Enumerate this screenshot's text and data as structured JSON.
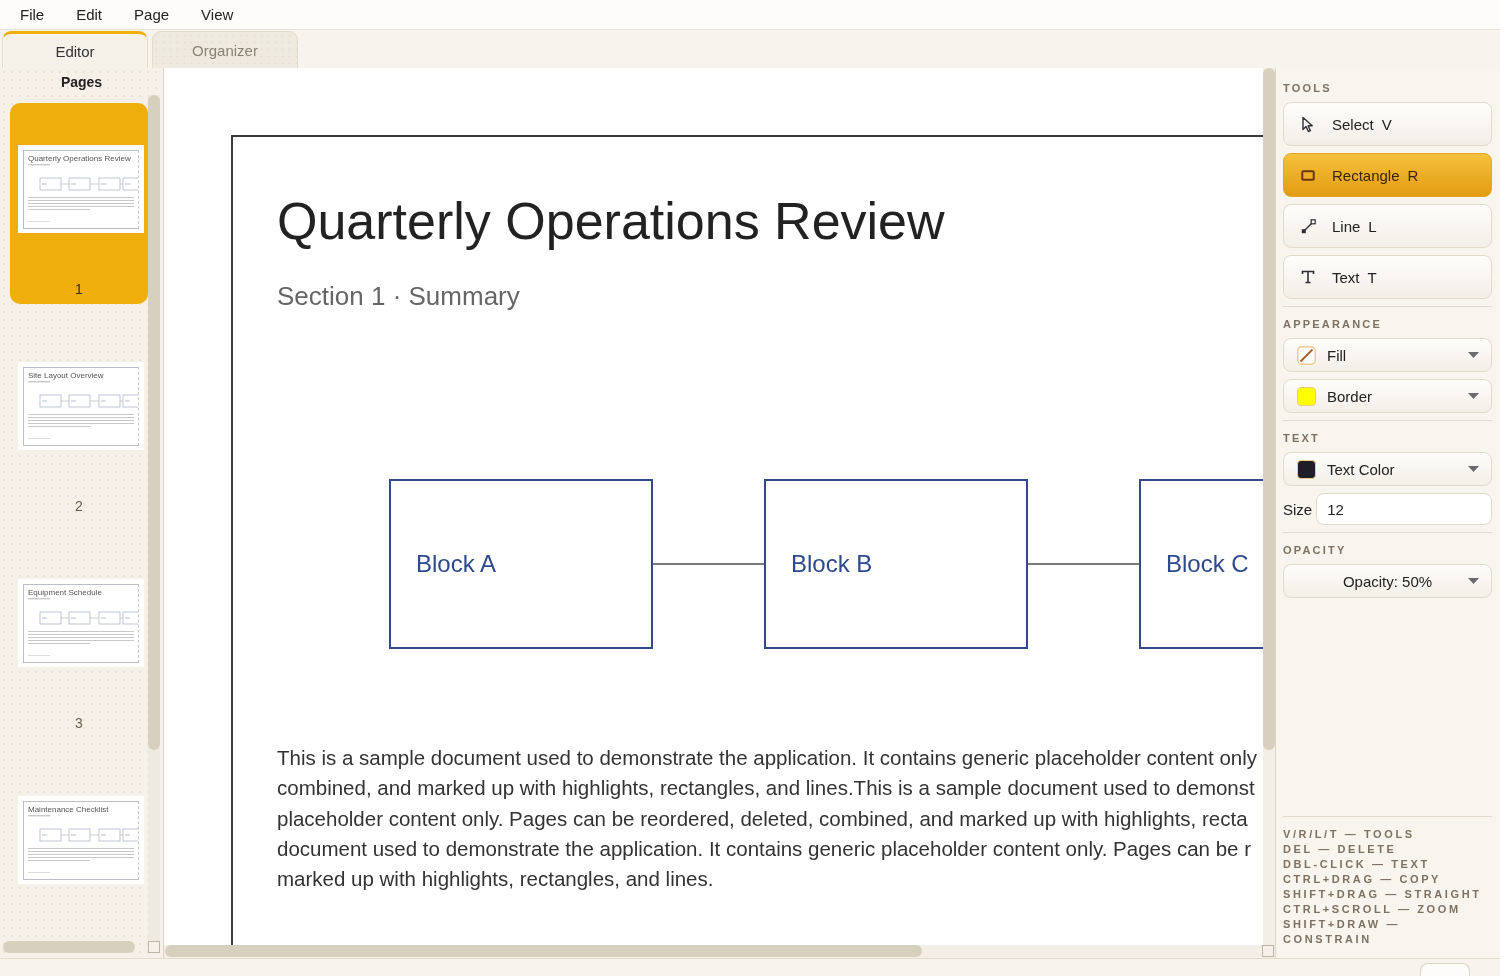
{
  "menu": [
    {
      "label": "File"
    },
    {
      "label": "Edit"
    },
    {
      "label": "Page"
    },
    {
      "label": "View"
    }
  ],
  "tabs": [
    {
      "label": "Editor",
      "selected": true
    },
    {
      "label": "Organizer",
      "selected": false
    }
  ],
  "pages_panel": {
    "title": "Pages",
    "pages": [
      {
        "thumbnail_title": "Quarterly Operations Review",
        "number": "1",
        "selected": true
      },
      {
        "thumbnail_title": "Site Layout Overview",
        "number": "2",
        "selected": false
      },
      {
        "thumbnail_title": "Equipment Schedule",
        "number": "3",
        "selected": false
      },
      {
        "thumbnail_title": "Maintenance Checklist",
        "selected": false
      }
    ]
  },
  "document": {
    "title": "Quarterly Operations Review",
    "subtitle": "Section 1 · Summary",
    "blocks": [
      {
        "label": "Block A"
      },
      {
        "label": "Block B"
      },
      {
        "label": "Block C"
      }
    ],
    "body_lines": [
      "This is a sample document used to demonstrate the application. It contains generic placeholder content only",
      "combined, and marked up with highlights, rectangles, and lines.This is a sample document used to demonst",
      "placeholder content only. Pages can be reordered, deleted, combined, and marked up with highlights, recta",
      "document used to demonstrate the application. It contains generic placeholder content only. Pages can be r",
      "marked up with highlights, rectangles, and lines."
    ]
  },
  "tools": {
    "heading": "TOOLS",
    "items": [
      {
        "kind": "select",
        "label": "Select",
        "key": "V",
        "selected": false
      },
      {
        "kind": "rectangle",
        "label": "Rectangle",
        "key": "R",
        "selected": true
      },
      {
        "kind": "line",
        "label": "Line",
        "key": "L",
        "selected": false
      },
      {
        "kind": "text",
        "label": "Text",
        "key": "T",
        "selected": false
      }
    ]
  },
  "appearance": {
    "heading": "APPEARANCE",
    "dropdowns": [
      {
        "kind": "no-fill",
        "label": "Fill"
      },
      {
        "kind": "swatch",
        "label": "Border",
        "color": "#ffff00"
      }
    ]
  },
  "text": {
    "heading": "TEXT",
    "dropdowns": [
      {
        "kind": "swatch",
        "label": "Text Color",
        "color": "#1e1e26"
      }
    ],
    "size": {
      "label": "Size",
      "value": "12"
    }
  },
  "opacity": {
    "heading": "OPACITY",
    "dropdowns": [
      {
        "kind": "plain",
        "label": "Opacity: 50%"
      }
    ]
  },
  "shortcuts": [
    "V/R/L/T — TOOLS",
    "DEL — DELETE",
    "DBL-CLICK — TEXT",
    "CTRL+DRAG — COPY",
    "SHIFT+DRAG — STRAIGHT",
    "CTRL+SCROLL — ZOOM",
    "SHIFT+DRAW — CONSTRAIN"
  ]
}
